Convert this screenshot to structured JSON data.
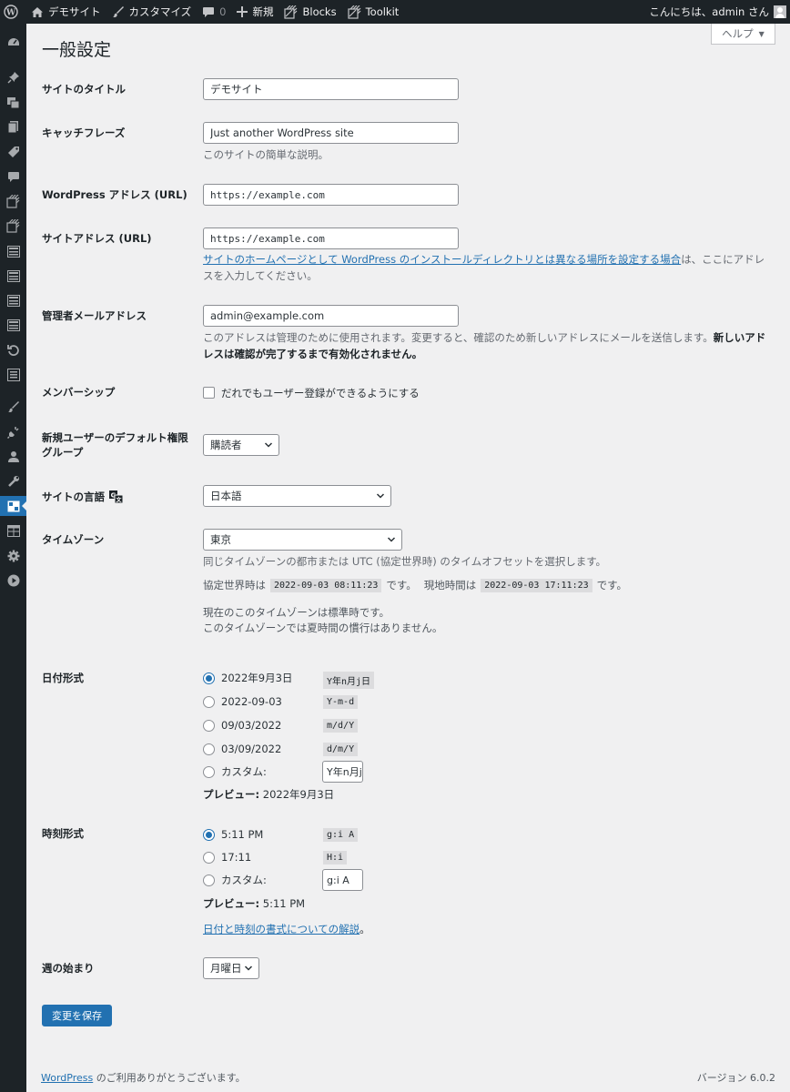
{
  "admin_bar": {
    "site_name": "デモサイト",
    "customize": "カスタマイズ",
    "comments_count": "0",
    "new": "新規",
    "blocks": "Blocks",
    "toolkit": "Toolkit",
    "greeting": "こんにちは、admin さん"
  },
  "help": {
    "label": "ヘルプ"
  },
  "page": {
    "title": "一般設定"
  },
  "fields": {
    "site_title": {
      "label": "サイトのタイトル",
      "value": "デモサイト"
    },
    "tagline": {
      "label": "キャッチフレーズ",
      "value": "Just another WordPress site",
      "desc": "このサイトの簡単な説明。"
    },
    "wp_address": {
      "label": "WordPress アドレス (URL)",
      "value": "https://example.com"
    },
    "site_address": {
      "label": "サイトアドレス (URL)",
      "value": "https://example.com",
      "desc_link": "サイトのホームページとして WordPress のインストールディレクトリとは異なる場所を設定する場合",
      "desc_rest": "は、ここにアドレスを入力してください。"
    },
    "admin_email": {
      "label": "管理者メールアドレス",
      "value": "admin@example.com",
      "desc": "このアドレスは管理のために使用されます。変更すると、確認のため新しいアドレスにメールを送信します。",
      "desc_bold": "新しいアドレスは確認が完了するまで有効化されません。"
    },
    "membership": {
      "label": "メンバーシップ",
      "checkbox_label": "だれでもユーザー登録ができるようにする",
      "checked": false
    },
    "default_role": {
      "label": "新規ユーザーのデフォルト権限グループ",
      "value": "購読者"
    },
    "site_language": {
      "label": "サイトの言語",
      "value": "日本語"
    },
    "timezone": {
      "label": "タイムゾーン",
      "value": "東京",
      "desc": "同じタイムゾーンの都市または UTC (協定世界時) のタイムオフセットを選択します。",
      "utc_label": "協定世界時は",
      "utc_time": "2022-09-03 08:11:23",
      "utc_suffix": "です。",
      "local_label": "現地時間は",
      "local_time": "2022-09-03 17:11:23",
      "local_suffix": "です。",
      "std_note": "現在のこのタイムゾーンは標準時です。",
      "dst_note": "このタイムゾーンでは夏時間の慣行はありません。"
    },
    "date_format": {
      "label": "日付形式",
      "options": [
        {
          "label": "2022年9月3日",
          "code": "Y年n月j日",
          "selected": true
        },
        {
          "label": "2022-09-03",
          "code": "Y-m-d",
          "selected": false
        },
        {
          "label": "09/03/2022",
          "code": "m/d/Y",
          "selected": false
        },
        {
          "label": "03/09/2022",
          "code": "d/m/Y",
          "selected": false
        }
      ],
      "custom_label": "カスタム:",
      "custom_value": "Y年n月j日",
      "preview_label": "プレビュー:",
      "preview_value": "2022年9月3日"
    },
    "time_format": {
      "label": "時刻形式",
      "options": [
        {
          "label": "5:11 PM",
          "code": "g:i A",
          "selected": true
        },
        {
          "label": "17:11",
          "code": "H:i",
          "selected": false
        }
      ],
      "custom_label": "カスタム:",
      "custom_value": "g:i A",
      "preview_label": "プレビュー:",
      "preview_value": "5:11 PM",
      "doc_link": "日付と時刻の書式についての解説",
      "doc_suffix": "。"
    },
    "week_start": {
      "label": "週の始まり",
      "value": "月曜日"
    }
  },
  "save_button": "変更を保存",
  "footer": {
    "wp_link": "WordPress",
    "thanks": " のご利用ありがとうございます。",
    "version": "バージョン 6.0.2"
  },
  "colors": {
    "accent": "#2271b1",
    "adminbar": "#1d2327",
    "background": "#f0f0f1"
  }
}
